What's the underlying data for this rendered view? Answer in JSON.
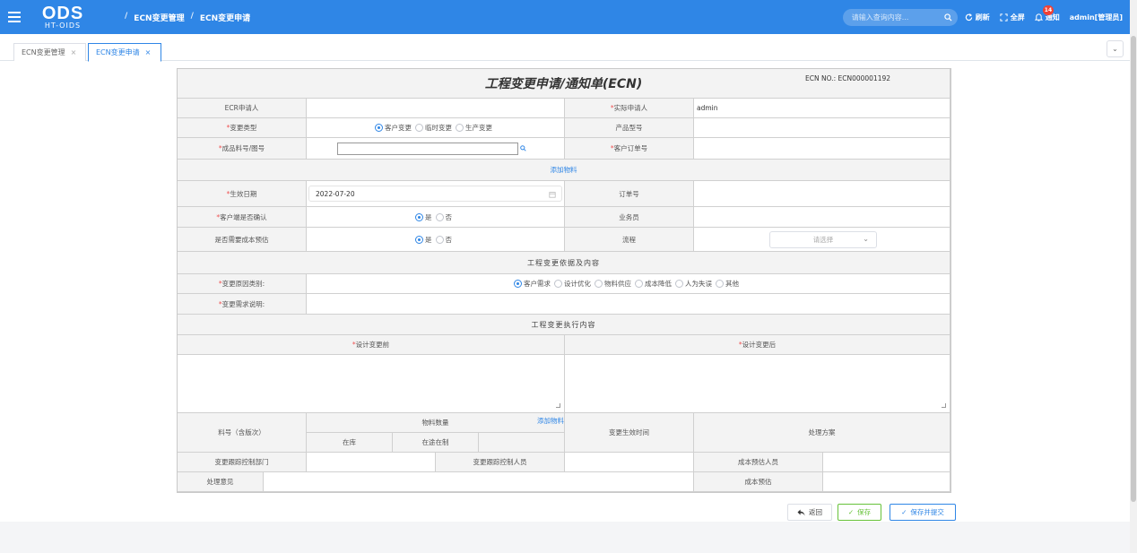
{
  "header": {
    "logo_main": "ODS",
    "logo_sub": "HT-OIDS",
    "breadcrumb": [
      "ECN变更管理",
      "ECN变更申请"
    ],
    "search_placeholder": "请输入查询内容...",
    "refresh_label": "刷新",
    "fullscreen_label": "全屏",
    "notify_label": "通知",
    "notify_count": "14",
    "user_label": "admin[管理员]"
  },
  "tabs": [
    {
      "label": "ECN变更管理",
      "active": false
    },
    {
      "label": "ECN变更申请",
      "active": true
    }
  ],
  "form": {
    "title": "工程变更申请/通知单(ECN)",
    "ecn_no_label": "ECN NO.:",
    "ecn_no_value": "ECN000001192",
    "ecr_applicant_label": "ECR申请人",
    "actual_applicant_label": "实际申请人",
    "actual_applicant_value": "admin",
    "change_type_label": "变更类型",
    "change_type_options": [
      "客户变更",
      "临时变更",
      "生产变更"
    ],
    "product_model_label": "产品型号",
    "finished_part_label": "成品料号/图号",
    "customer_order_label": "客户订单号",
    "add_material_label": "添加物料",
    "effective_date_label": "生效日期",
    "effective_date_value": "2022-07-20",
    "order_no_label": "订单号",
    "customer_confirm_label": "客户端是否确认",
    "yes_label": "是",
    "no_label": "否",
    "salesman_label": "业务员",
    "cost_estimate_need_label": "是否需要成本预估",
    "process_label": "流程",
    "process_placeholder": "请选择",
    "basis_section_title": "工程变更依据及内容",
    "reason_category_label": "变更原因类别:",
    "reason_options": [
      "客户需求",
      "设计优化",
      "物料供应",
      "成本降低",
      "人为失误",
      "其他"
    ],
    "requirement_desc_label": "变更需求说明:",
    "execution_section_title": "工程变更执行内容",
    "design_before_label": "设计变更前",
    "design_after_label": "设计变更后",
    "part_no_version_label": "料号（含版次）",
    "material_qty_label": "物料数量",
    "add_material_link": "添加物料",
    "in_stock_label": "在库",
    "in_transit_label": "在途在制",
    "effective_time_label": "变更生效时间",
    "solution_label": "处理方案",
    "tracking_dept_label": "变更跟踪控制部门",
    "tracking_person_label": "变更跟踪控制人员",
    "cost_estimator_label": "成本预估人员",
    "opinion_label": "处理意见",
    "cost_estimate_label": "成本预估"
  },
  "actions": {
    "back_label": "返回",
    "save_label": "保存",
    "save_submit_label": "保存并提交"
  },
  "colors": {
    "primary": "#2f86e6",
    "success": "#67c23a",
    "required": "#e55555"
  }
}
